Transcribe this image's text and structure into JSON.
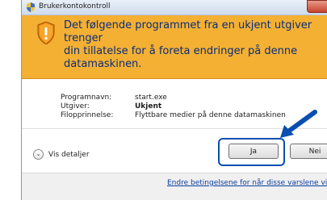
{
  "window": {
    "title": "Brukerkontokontroll"
  },
  "banner": {
    "message": "Det følgende programmet fra en ukjent utgiver trenger\ndin tillatelse for å foreta endringer på denne\ndatamaskinen."
  },
  "info": {
    "rows": [
      {
        "label": "Programnavn:",
        "value": "start.exe"
      },
      {
        "label": "Utgiver:",
        "value": "Ukjent"
      },
      {
        "label": "Filopprinnelse:",
        "value": "Flyttbare medier på denne datamaskinen"
      }
    ]
  },
  "details": {
    "label": "Vis detaljer"
  },
  "buttons": {
    "yes": "Ja",
    "no": "Nei"
  },
  "link": {
    "text": "Endre betingelsene for når disse varslene vis"
  },
  "colors": {
    "banner": "#f3b033",
    "banner_text": "#0b2d7a",
    "link": "#0a3ea0",
    "highlight": "#0b4eb0"
  },
  "icons": [
    "uac-shield-icon",
    "warning-shield-icon",
    "chevron-down-icon",
    "close-icon",
    "pointer-arrow-icon"
  ]
}
